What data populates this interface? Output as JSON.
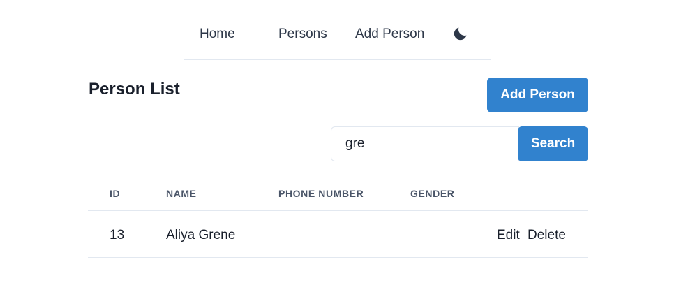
{
  "nav": {
    "home": "Home",
    "persons": "Persons",
    "add_person": "Add Person",
    "theme_icon": "moon-icon"
  },
  "page": {
    "title": "Person List",
    "add_button": "Add Person"
  },
  "search": {
    "value": "gre",
    "button": "Search"
  },
  "table": {
    "headers": [
      "ID",
      "NAME",
      "PHONE NUMBER",
      "GENDER"
    ],
    "rows": [
      {
        "id": "13",
        "name": "Aliya Grene",
        "phone": "",
        "gender": "",
        "edit": "Edit",
        "delete": "Delete"
      }
    ]
  },
  "colors": {
    "accent": "#3182ce",
    "text": "#1a202c",
    "muted": "#4a5568",
    "border": "#e2e8f0"
  }
}
